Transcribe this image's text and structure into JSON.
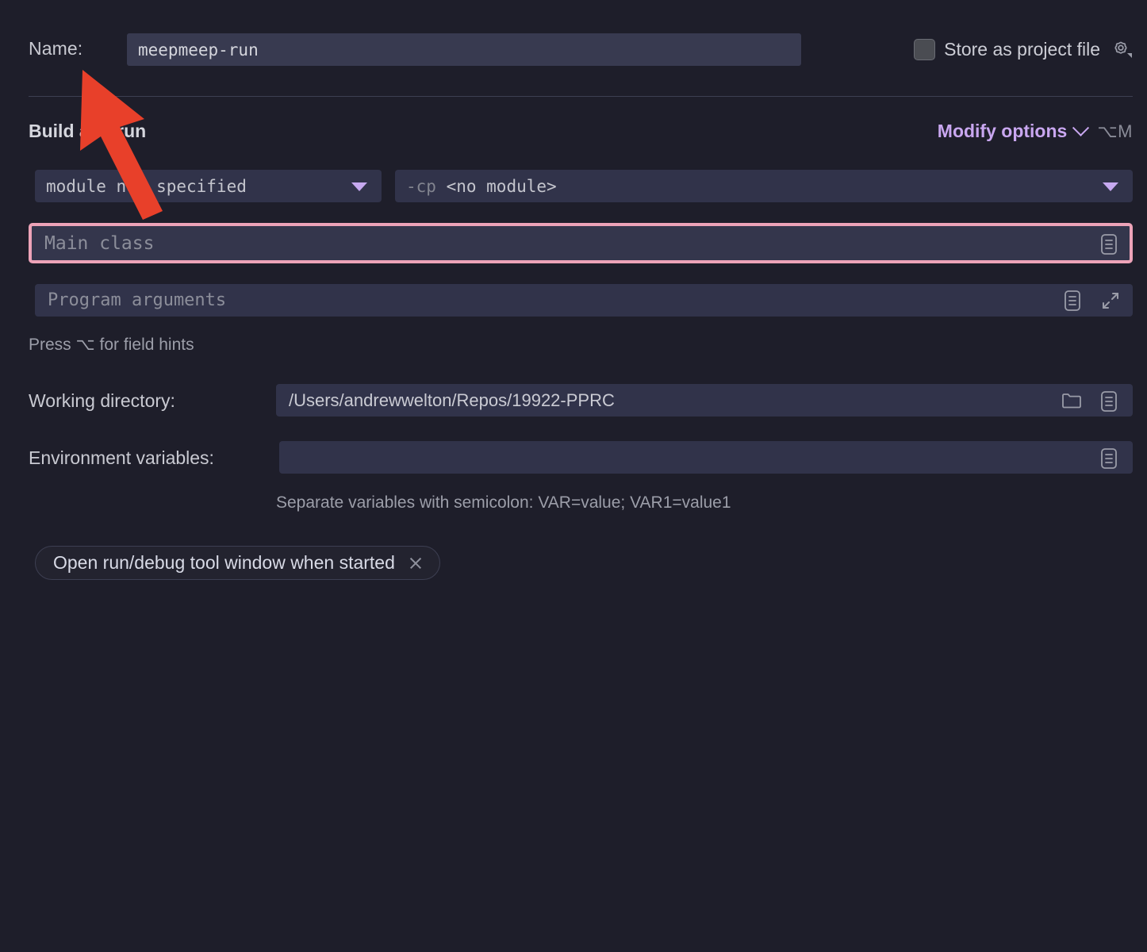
{
  "name_row": {
    "label": "Name:",
    "value": "meepmeep-run",
    "store_label": "Store as project file",
    "store_checked": false,
    "gear_icon": "gear-icon"
  },
  "section": {
    "title": "Build and run",
    "modify_label": "Modify options",
    "modify_shortcut": "⌥M"
  },
  "build": {
    "module_value": "module not specified",
    "cp_flag": "-cp",
    "cp_value": "<no module>",
    "main_class_placeholder": "Main class",
    "program_args_placeholder": "Program arguments",
    "field_hint": "Press ⌥ for field hints"
  },
  "working_directory": {
    "label": "Working directory:",
    "value": "/Users/andrewwelton/Repos/19922-PPRC"
  },
  "environment": {
    "label": "Environment variables:",
    "value": "",
    "hint": "Separate variables with semicolon: VAR=value; VAR1=value1"
  },
  "chip": {
    "label": "Open run/debug tool window when started",
    "close_icon": "close-icon"
  },
  "colors": {
    "background": "#1e1e2a",
    "field": "#31334a",
    "name_field": "#383a50",
    "accent_purple": "#c9a7f0",
    "error_border": "#eda3b8",
    "annotation_arrow": "#e8402a",
    "text_primary": "#c9cad2",
    "text_muted": "#8c8e9a"
  },
  "annotation": {
    "arrow": "red-arrow-pointing-to-name-field"
  }
}
